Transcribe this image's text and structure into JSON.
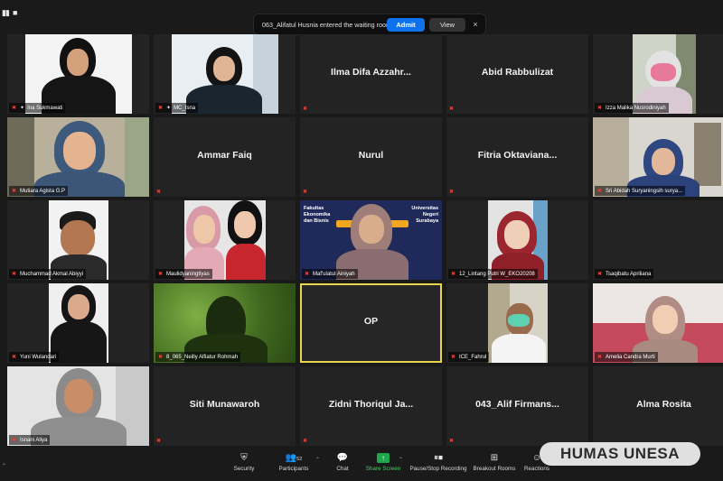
{
  "meeting": {
    "notification": {
      "text": "063_Alifatul Husnia entered the waiting room",
      "admit_label": "Admit",
      "view_label": "View",
      "close_glyph": "×"
    },
    "participants": [
      {
        "id": "p1",
        "name": "Ina Sukmawati",
        "video": true,
        "pinned": true
      },
      {
        "id": "p2",
        "name": "MC_Isna",
        "video": true,
        "pinned": true
      },
      {
        "id": "p3",
        "name": "Ilma Difa Azzahr...",
        "video": false
      },
      {
        "id": "p4",
        "name": "Abid Rabbulizat",
        "video": false
      },
      {
        "id": "p5",
        "name": "Izza Malika Nusrodiniyah",
        "video": true
      },
      {
        "id": "p6",
        "name": "Mutiara Agista G.P",
        "video": true
      },
      {
        "id": "p7",
        "name": "Ammar Faiq",
        "video": false
      },
      {
        "id": "p8",
        "name": "Nurul",
        "video": false
      },
      {
        "id": "p9",
        "name": "Fitria Oktaviana...",
        "video": false
      },
      {
        "id": "p10",
        "name": "Sri Abidah Suryaningsih surya...",
        "video": true
      },
      {
        "id": "p11",
        "name": "Muchammad Akmal Abiyyi",
        "video": true
      },
      {
        "id": "p12",
        "name": "Maulidyaningtiyas",
        "video": true
      },
      {
        "id": "p13",
        "name": "Maf'ulatul Ainiyah",
        "video": true,
        "bg_text_left": [
          "Fakultas",
          "Ekonomika",
          "dan Bisnis"
        ],
        "bg_text_right": [
          "Universitas",
          "Negeri",
          "Surabaya"
        ]
      },
      {
        "id": "p14",
        "name": "12_Lintang Putri W_EKO20208",
        "video": true
      },
      {
        "id": "p15",
        "name": "Tsaqibatu Apriliana",
        "video": false
      },
      {
        "id": "p16",
        "name": "Yuni Wulandari",
        "video": true
      },
      {
        "id": "p17",
        "name": "8_065_Neilly Alfiatur Rohmah",
        "video": true
      },
      {
        "id": "p18",
        "name": "OP",
        "video": false,
        "active": true
      },
      {
        "id": "p19",
        "name": "ICE_Fahrul",
        "video": true
      },
      {
        "id": "p20",
        "name": "Amelia Candra Murti",
        "video": true
      },
      {
        "id": "p21",
        "name": "Isnani Aliya",
        "video": true
      },
      {
        "id": "p22",
        "name": "Siti Munawaroh",
        "video": false
      },
      {
        "id": "p23",
        "name": "Zidni Thoriqul Ja...",
        "video": false
      },
      {
        "id": "p24",
        "name": "043_Alif Firmans...",
        "video": false
      },
      {
        "id": "p25",
        "name": "Alma Rosita",
        "video": false
      }
    ],
    "toolbar": {
      "security": "Security",
      "participants": "Participants",
      "participants_count": "52",
      "chat": "Chat",
      "share_screen": "Share Screen",
      "pause_recording": "Pause/Stop Recording",
      "breakout_rooms": "Breakout Rooms",
      "reactions": "Reactions"
    },
    "watermark": "HUMAS UNESA",
    "colors": {
      "muted": "#e0433b",
      "admit": "#0e72ed",
      "share": "#1ea84b",
      "active_speaker": "#e8d44d"
    }
  }
}
